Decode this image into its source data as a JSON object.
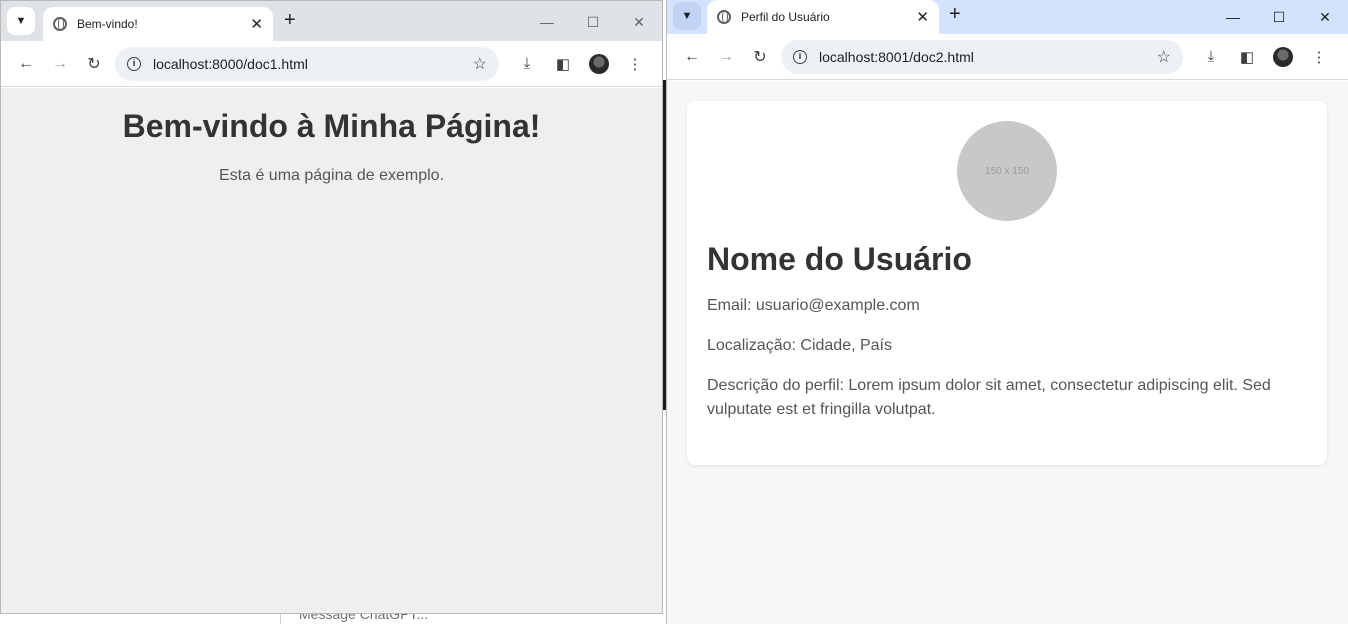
{
  "background": {
    "partial_text": "Message ChatGPT..."
  },
  "window1": {
    "tab_title": "Bem-vindo!",
    "url": "localhost:8000/doc1.html",
    "heading": "Bem-vindo à Minha Página!",
    "paragraph": "Esta é uma página de exemplo."
  },
  "window2": {
    "tab_title": "Perfil do Usuário",
    "url": "localhost:8001/doc2.html",
    "photo_placeholder": "150 x 150",
    "name": "Nome do Usuário",
    "email": "Email: usuario@example.com",
    "location": "Localização: Cidade, País",
    "description": "Descrição do perfil: Lorem ipsum dolor sit amet, consectetur adipiscing elit. Sed vulputate est et fringilla volutpat."
  }
}
